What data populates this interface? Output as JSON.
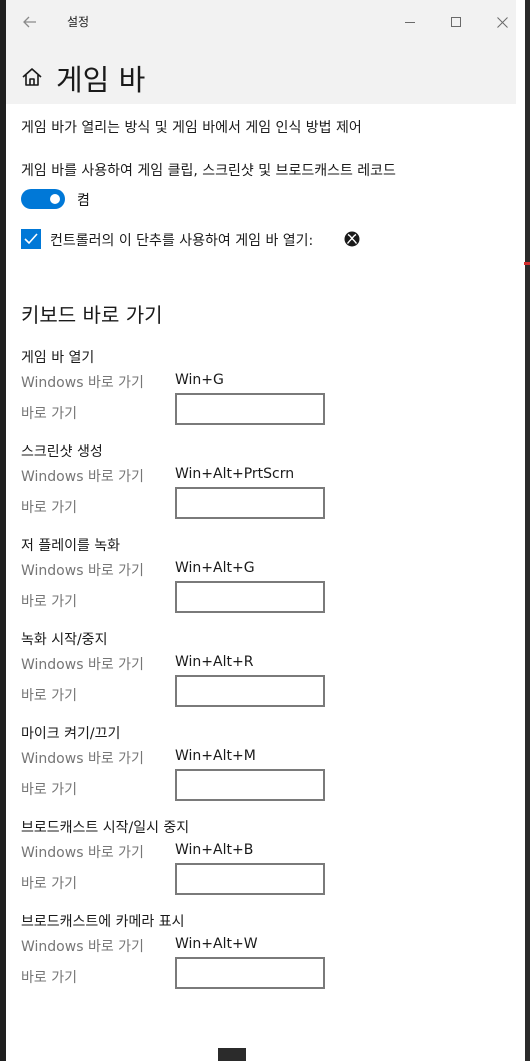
{
  "window": {
    "title": "설정",
    "back_icon": "back-arrow-icon",
    "minimize_icon": "minimize-icon",
    "maximize_icon": "maximize-icon",
    "close_icon": "close-icon"
  },
  "header": {
    "icon": "home-icon",
    "title": "게임 바"
  },
  "description": "게임 바가 열리는 방식 및 게임 바에서 게임 인식 방법 제어",
  "record_toggle": {
    "label": "게임 바를 사용하여 게임 클립, 스크린샷 및 브로드캐스트 레코드",
    "state_label": "켬",
    "on": true
  },
  "controller_checkbox": {
    "label": "컨트롤러의 이 단추를 사용하여 게임 바 열기:",
    "checked": true,
    "icon": "xbox-icon"
  },
  "shortcuts_section": {
    "title": "키보드 바로 가기",
    "windows_label": "Windows 바로 가기",
    "custom_label": "바로 가기",
    "items": [
      {
        "name": "게임 바 열기",
        "windows_shortcut": "Win+G",
        "custom": ""
      },
      {
        "name": "스크린샷 생성",
        "windows_shortcut": "Win+Alt+PrtScrn",
        "custom": ""
      },
      {
        "name": "저 플레이를 녹화",
        "windows_shortcut": "Win+Alt+G",
        "custom": ""
      },
      {
        "name": "녹화 시작/중지",
        "windows_shortcut": "Win+Alt+R",
        "custom": ""
      },
      {
        "name": "마이크 켜기/끄기",
        "windows_shortcut": "Win+Alt+M",
        "custom": ""
      },
      {
        "name": "브로드캐스트 시작/일시 중지",
        "windows_shortcut": "Win+Alt+B",
        "custom": ""
      },
      {
        "name": "브로드캐스트에 카메라 표시",
        "windows_shortcut": "Win+Alt+W",
        "custom": ""
      }
    ]
  },
  "colors": {
    "accent": "#0078d7",
    "header_bg": "#f2f2f2",
    "secondary_text": "#767676"
  }
}
